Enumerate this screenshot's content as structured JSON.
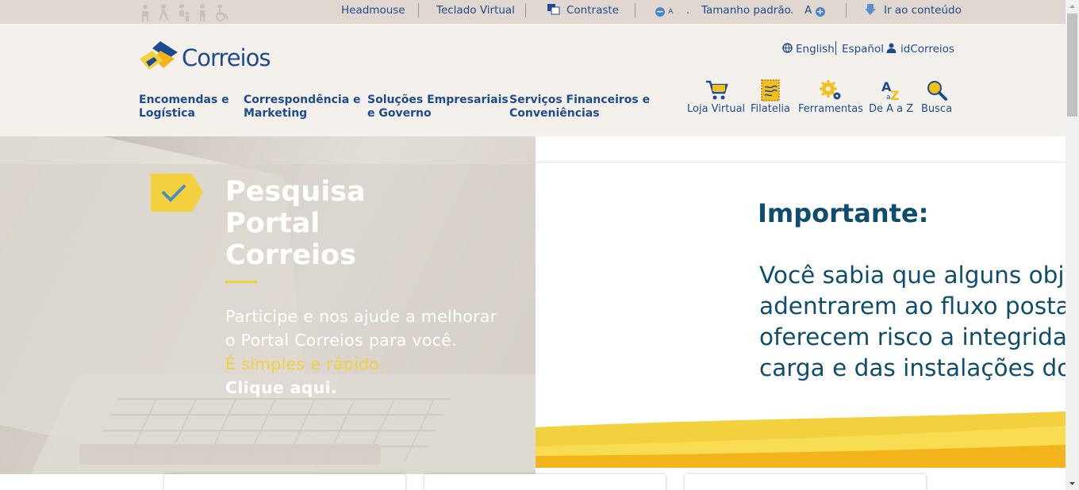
{
  "accessibility_bar": {
    "headmouse": "Headmouse",
    "teclado_virtual": "Teclado Virtual",
    "contraste": "Contraste",
    "font_decrease": "A",
    "dot1": ".",
    "tamanho_padrao": "Tamanho padrão",
    "dot2": ".",
    "font_increase": "A",
    "ir_ao_conteudo": "Ir ao conteúdo"
  },
  "header": {
    "logo_text": "Correios",
    "languages": [
      "English",
      "Español"
    ],
    "account": "idCorreios",
    "nav": [
      {
        "line1": "Encomendas e",
        "line2": "Logística"
      },
      {
        "line1": "Correspondência e",
        "line2": "Marketing"
      },
      {
        "line1": "Soluções Empresariais",
        "line2": "e Governo"
      },
      {
        "line1": "Serviços Financeiros e",
        "line2": "Conveniências"
      }
    ],
    "tools": [
      "Loja Virtual",
      "Filatelia",
      "Ferramentas",
      "De A a Z",
      "Busca"
    ]
  },
  "promo": {
    "title": [
      "Pesquisa",
      "Portal",
      "Correios"
    ],
    "line1": "Participe e nos ajude a melhorar",
    "line2": "o Portal Correios para você.",
    "line3": "É simples e rápido.",
    "line4": "Clique aqui."
  },
  "banner": {
    "title": "Importante:",
    "lines": [
      "Você sabia que alguns obj",
      "adentrarem ao fluxo posta",
      "oferecem risco a integrida",
      "carga e das instalações do"
    ]
  },
  "colors": {
    "brand_blue": "#1e4b8e",
    "brand_yellow": "#f3d03d",
    "banner_text": "#0e4d6e",
    "acc_bar": "#e0d8d0",
    "header_bg": "#f4f1ed"
  }
}
